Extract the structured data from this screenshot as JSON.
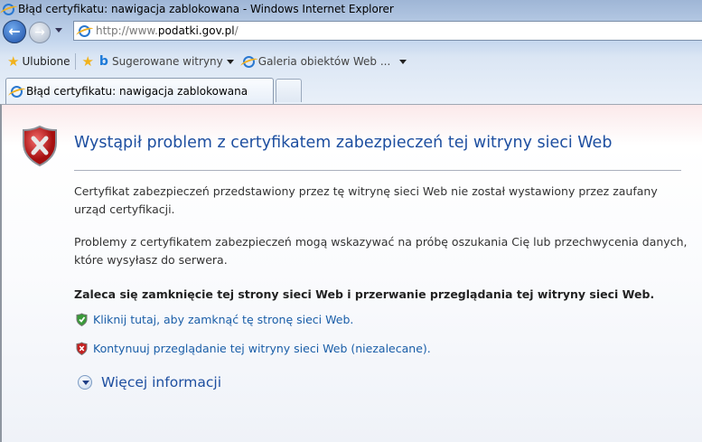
{
  "window": {
    "title": "Błąd certyfikatu: nawigacja zablokowana - Windows Internet Explorer"
  },
  "address": {
    "prefix": "http://www.",
    "domain": "podatki.gov.pl",
    "suffix": "/"
  },
  "favorites": {
    "label": "Ulubione",
    "items": [
      "Sugerowane witryny",
      "Galeria obiektów Web ..."
    ]
  },
  "tab": {
    "label": "Błąd certyfikatu: nawigacja zablokowana"
  },
  "page": {
    "heading": "Wystąpił problem z certyfikatem zabezpieczeń tej witryny sieci Web",
    "p1": "Certyfikat zabezpieczeń przedstawiony przez tę witrynę sieci Web nie został wystawiony przez zaufany urząd certyfikacji.",
    "p2": "Problemy z certyfikatem zabezpieczeń mogą wskazywać na próbę oszukania Cię lub przechwycenia danych, które wysyłasz do serwera.",
    "recommend": "Zaleca się zamknięcie tej strony sieci Web i przerwanie przeglądania tej witryny sieci Web.",
    "close_link": "Kliknij tutaj, aby zamknąć tę stronę sieci Web.",
    "continue_link": "Kontynuuj przeglądanie tej witryny sieci Web (niezalecane).",
    "more_info": "Więcej informacji"
  }
}
